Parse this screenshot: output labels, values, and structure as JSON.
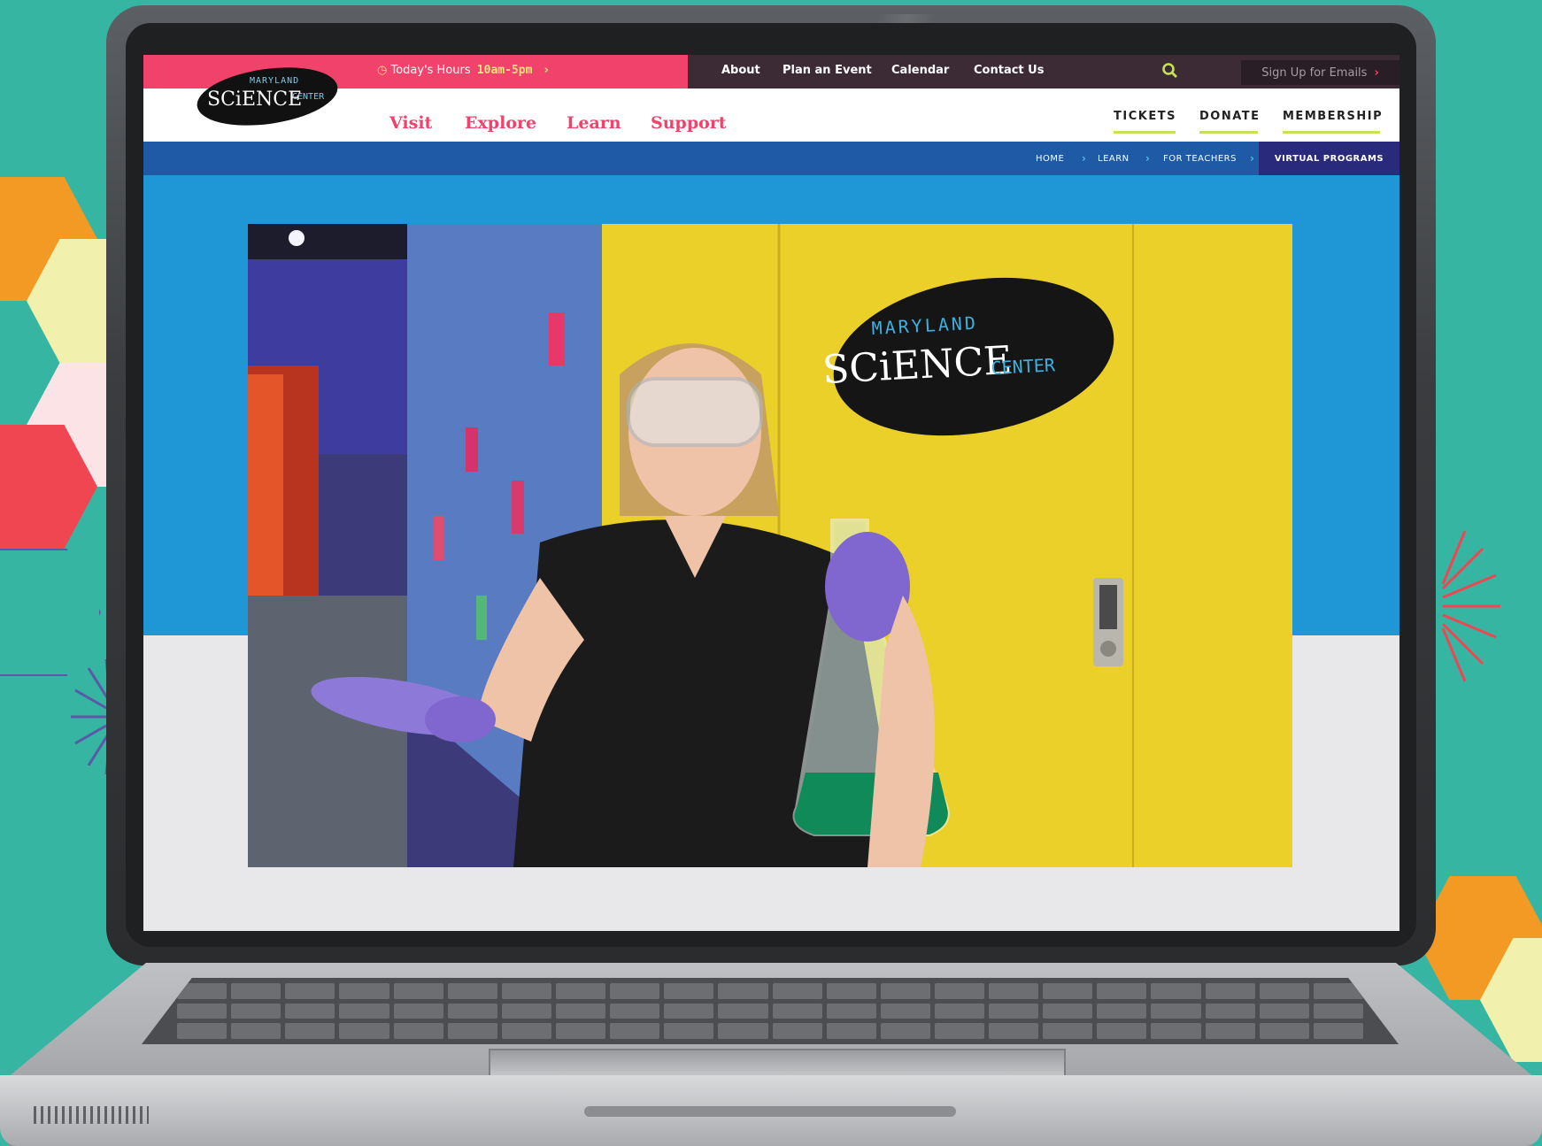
{
  "topbar": {
    "hours_label": "Today's Hours",
    "hours_value": "10am-5pm",
    "links": [
      "About",
      "Plan an Event",
      "Calendar",
      "Contact Us"
    ],
    "signup": "Sign Up for Emails"
  },
  "logo": {
    "line1": "MARYLAND",
    "line2": "SCiENCE",
    "line3": "CENTER"
  },
  "nav": {
    "main": [
      "Visit",
      "Explore",
      "Learn",
      "Support"
    ],
    "cta": [
      "TICKETS",
      "DONATE",
      "MEMBERSHIP"
    ]
  },
  "breadcrumb": {
    "items": [
      "HOME",
      "LEARN",
      "FOR TEACHERS"
    ],
    "current": "VIRTUAL PROGRAMS"
  },
  "photo_sign": {
    "line1": "MARYLAND",
    "line2": "SCiENCE",
    "line3": "CENTER"
  },
  "colors": {
    "teal_background": "#36b5a2",
    "brand_pink": "#f0426a",
    "nav_dark": "#3c2b35",
    "breadcrumb_blue": "#1e5aa5",
    "hero_blue": "#1f97d7",
    "accent_lime": "#c5e155"
  }
}
